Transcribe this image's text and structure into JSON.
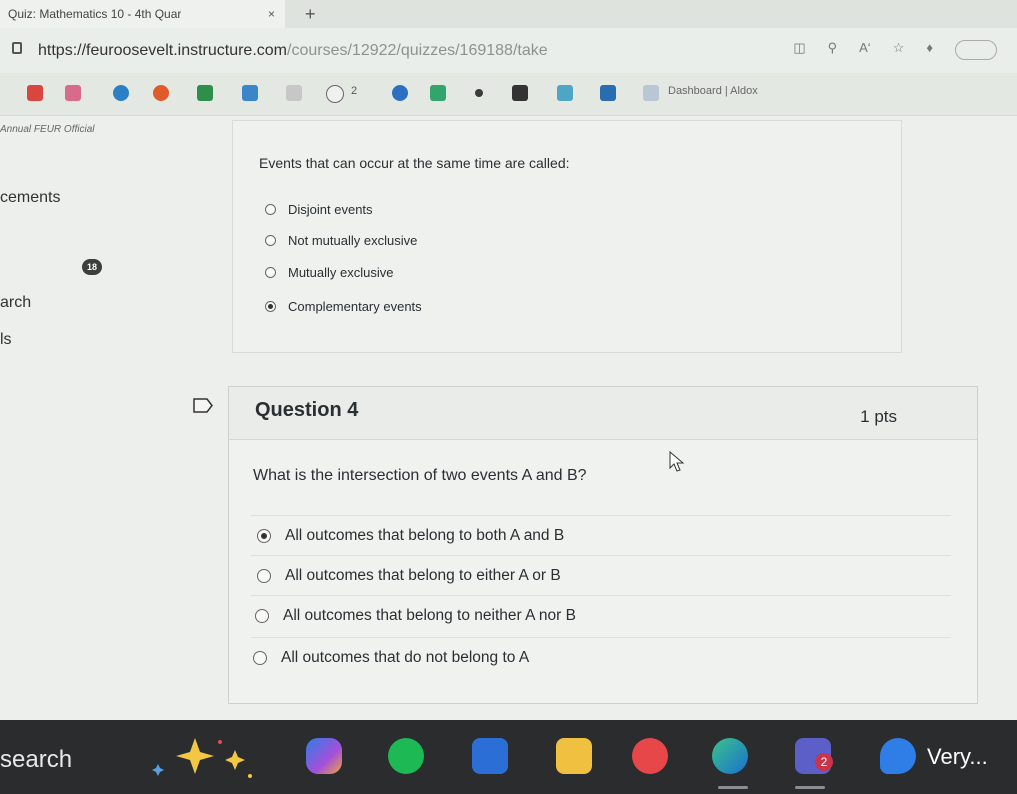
{
  "browser": {
    "tab_title": "Quiz: Mathematics 10 - 4th Quar",
    "tab_close": "×",
    "new_tab": "+",
    "url_main": "https://feuroosevelt.instructure.com",
    "url_rest": "/courses/12922/quizzes/169188/take",
    "bookmark_label": "Dashboard | Aldox",
    "bookmark_count": "2"
  },
  "sidebar": {
    "header": "Annual FEUR Official",
    "items": [
      "cements",
      "arch",
      "ls"
    ],
    "badge": "18"
  },
  "question3": {
    "text": "Events that can occur at the same time are called:",
    "options": [
      "Disjoint events",
      "Not mutually exclusive",
      "Mutually exclusive",
      "Complementary events"
    ],
    "selected_index": 3
  },
  "question4": {
    "title": "Question 4",
    "points": "1 pts",
    "text": "What is the intersection of two events A and B?",
    "options": [
      "All outcomes that belong to both A and B",
      "All outcomes that belong to either A or B",
      "All outcomes that belong to neither A nor B",
      "All outcomes that do not belong to A"
    ],
    "selected_index": 0
  },
  "taskbar": {
    "search_label": "search",
    "teams_badge": "2",
    "weather_text": "Very..."
  },
  "colors": {
    "taskbar_bg": "#2a2c2e",
    "page_bg": "#ecefeb",
    "accent_red": "#c9344a"
  }
}
